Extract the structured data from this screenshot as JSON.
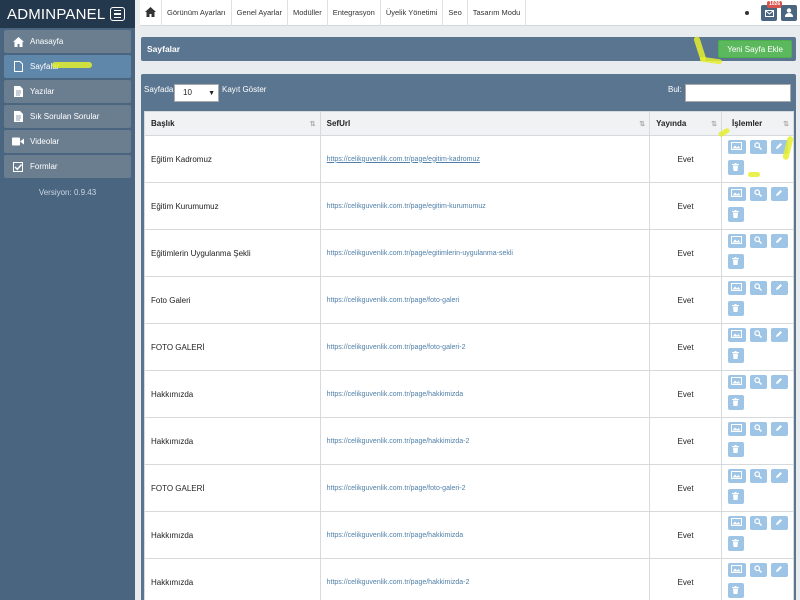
{
  "brand": {
    "title": "ADMINPANEL"
  },
  "sidebar": {
    "items": [
      {
        "label": "Anasayfa",
        "icon": "home-icon",
        "active": false
      },
      {
        "label": "Sayfalar",
        "icon": "file-icon",
        "active": true
      },
      {
        "label": "Yazılar",
        "icon": "document-icon",
        "active": false
      },
      {
        "label": "Sık Sorulan Sorular",
        "icon": "question-icon",
        "active": false
      },
      {
        "label": "Videolar",
        "icon": "video-icon",
        "active": false
      },
      {
        "label": "Formlar",
        "icon": "checkbox-icon",
        "active": false
      }
    ],
    "version": "Versiyon: 0.9.43"
  },
  "topbar": {
    "items": [
      "Görünüm Ayarları",
      "Genel Ayarlar",
      "Modüller",
      "Entegrasyon",
      "Üyelik Yönetimi",
      "Seo",
      "Tasarım Modu"
    ],
    "notification_count": "1026"
  },
  "page": {
    "title": "Sayfalar",
    "add_button": "Yeni Sayfa Ekle",
    "per_page_prefix": "Sayfada",
    "per_page_value": "10",
    "per_page_suffix": "Kayıt Göster",
    "search_label": "Bul:",
    "search_value": ""
  },
  "table": {
    "columns": [
      "Başlık",
      "SefUrl",
      "Yayında",
      "İşlemler"
    ],
    "rows": [
      {
        "title": "Eğitim Kadromuz",
        "url": "https://celikguvenlik.com.tr/page/egitim-kadromuz",
        "published": "Evet"
      },
      {
        "title": "Eğitim Kurumumuz",
        "url": "https://celikguvenlik.com.tr/page/egitim-kurumumuz",
        "published": "Evet"
      },
      {
        "title": "Eğitimlerin Uygulanma Şekli",
        "url": "https://celikguvenlik.com.tr/page/egitimlerin-uygulanma-sekli",
        "published": "Evet"
      },
      {
        "title": "Foto Galeri",
        "url": "https://celikguvenlik.com.tr/page/foto-galeri",
        "published": "Evet"
      },
      {
        "title": "FOTO GALERİ",
        "url": "https://celikguvenlik.com.tr/page/foto-galeri-2",
        "published": "Evet"
      },
      {
        "title": "Hakkımızda",
        "url": "https://celikguvenlik.com.tr/page/hakkimizda",
        "published": "Evet"
      },
      {
        "title": "Hakkımızda",
        "url": "https://celikguvenlik.com.tr/page/hakkimizda-2",
        "published": "Evet"
      },
      {
        "title": "FOTO GALERİ",
        "url": "https://celikguvenlik.com.tr/page/foto-galeri-2",
        "published": "Evet"
      },
      {
        "title": "Hakkımızda",
        "url": "https://celikguvenlik.com.tr/page/hakkimizda",
        "published": "Evet"
      },
      {
        "title": "Hakkımızda",
        "url": "https://celikguvenlik.com.tr/page/hakkimizda-2",
        "published": "Evet"
      }
    ]
  },
  "colors": {
    "sidebar": "#4a6580",
    "brand_bar": "#24384d",
    "panel": "#5a7590",
    "add_button": "#5cb85c",
    "action_button": "#9ec5e6",
    "highlighter": "#e4ef2e"
  }
}
